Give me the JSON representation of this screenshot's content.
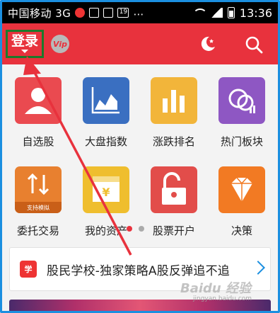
{
  "status_bar": {
    "carrier": "中国移动 3G",
    "time": "13:36",
    "sim_badge": "19"
  },
  "header": {
    "login_label": "登录",
    "vip_label": "Vip"
  },
  "tiles": [
    {
      "label": "自选股",
      "icon": "person-icon",
      "color": "#ea4a50"
    },
    {
      "label": "大盘指数",
      "icon": "area-chart-icon",
      "color": "#3a6fc1"
    },
    {
      "label": "涨跌排名",
      "icon": "bar-chart-icon",
      "color": "#f2b53a"
    },
    {
      "label": "热门板块",
      "icon": "sector-icon",
      "color": "#8e57c3"
    },
    {
      "label": "委托交易",
      "icon": "trade-icon",
      "color": "#e8802f",
      "sub": "支持模拟"
    },
    {
      "label": "我的资产",
      "icon": "wallet-icon",
      "color": "#efbe2e"
    },
    {
      "label": "股票开户",
      "icon": "unlock-icon",
      "color": "#e24d4a"
    },
    {
      "label": "决策",
      "icon": "diamond-icon",
      "color": "#f27a23"
    }
  ],
  "banner": {
    "icon_text": "学",
    "text": "股民学校-独家策略A股反弹追不追"
  },
  "watermark": {
    "brand": "Baidu 经验",
    "url": "jingyan.baidu.com"
  },
  "colors": {
    "header_red": "#e8323d",
    "annotation_red": "#e8323d",
    "highlight_green": "#1c7a2b"
  }
}
